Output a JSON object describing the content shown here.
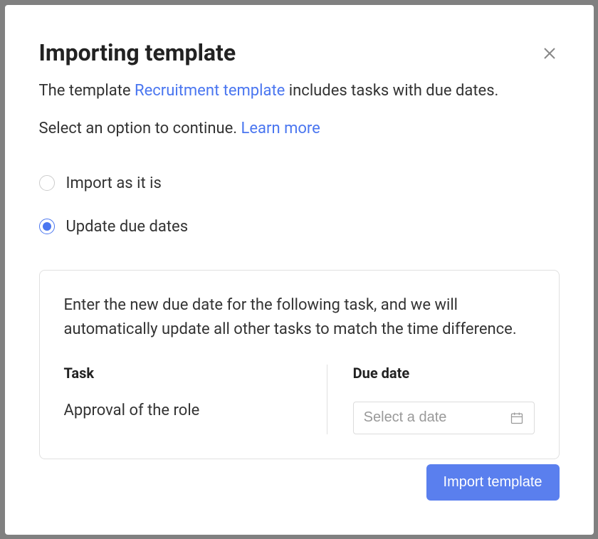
{
  "modal": {
    "title": "Importing template",
    "description_prefix": "The template ",
    "template_link_text": "Recruitment template",
    "description_suffix": " includes tasks with due dates.",
    "prompt_prefix": "Select an option to continue. ",
    "learn_more_text": "Learn more"
  },
  "options": {
    "import_as_is": "Import as it is",
    "update_due_dates": "Update due dates",
    "selected": "update_due_dates"
  },
  "panel": {
    "instruction": "Enter the new due date for the following task, and we will automatically update all other tasks to match the time difference.",
    "task_header": "Task",
    "duedate_header": "Due date",
    "task_name": "Approval of the role",
    "date_placeholder": "Select a date",
    "date_value": ""
  },
  "footer": {
    "import_button": "Import template"
  }
}
